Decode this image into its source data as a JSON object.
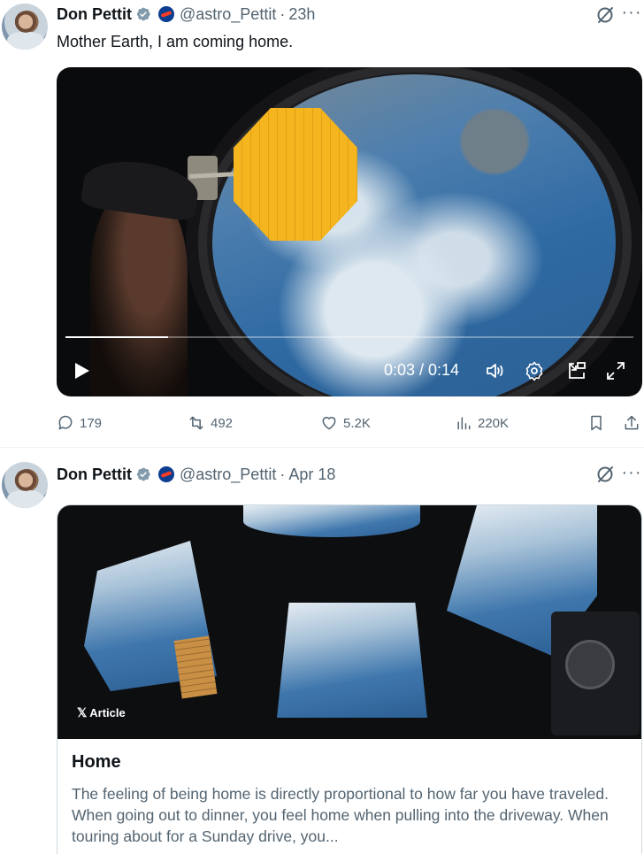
{
  "tweets": [
    {
      "author": {
        "name": "Don Pettit",
        "handle": "@astro_Pettit",
        "time": "23h"
      },
      "text": "Mother Earth, I am coming home.",
      "video": {
        "time_display": "0:03 / 0:14",
        "progress": 0.18
      },
      "stats": {
        "replies": "179",
        "reposts": "492",
        "likes": "5.2K",
        "views": "220K"
      }
    },
    {
      "author": {
        "name": "Don Pettit",
        "handle": "@astro_Pettit",
        "time": "Apr 18"
      },
      "article": {
        "badge": "Article",
        "badge_logo": "𝕏",
        "title": "Home",
        "excerpt": "The feeling of being home is directly proportional to how far you have traveled.  When going out to dinner, you feel home when pulling into the driveway.  When touring about for a Sunday drive, you..."
      }
    }
  ],
  "ui": {
    "dot": "·",
    "more": "···"
  },
  "colors": {
    "text": "#0f1419",
    "secondary": "#536471",
    "verified": "#829aab",
    "border": "#cfd9de",
    "agency": "#0b3d91"
  }
}
